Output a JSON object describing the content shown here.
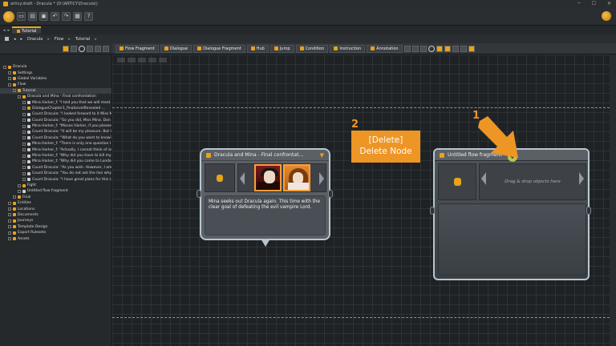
{
  "window": {
    "title": "articy:draft - Dracula * (D:\\ARTICY\\Dracula\\)"
  },
  "tabs": [
    {
      "label": "Tutorial"
    }
  ],
  "breadcrumb": {
    "items": [
      "Dracula",
      "Flow",
      "Tutorial"
    ]
  },
  "editor_toolbar": {
    "items": [
      "Flow Fragment",
      "Dialogue",
      "Dialogue Fragment",
      "Hub",
      "Jump",
      "Condition",
      "Instruction",
      "Annotation"
    ]
  },
  "tree": {
    "items": [
      {
        "label": "Dracula",
        "level": 0,
        "icon": "project-icon"
      },
      {
        "label": "Settings",
        "level": 1,
        "icon": "gear-icon"
      },
      {
        "label": "Global Variables",
        "level": 1,
        "icon": "variables-icon"
      },
      {
        "label": "Flow",
        "level": 1,
        "icon": "folder-icon"
      },
      {
        "label": "Tutorial",
        "level": 2,
        "icon": "folder-icon",
        "selected": true
      },
      {
        "label": "Dracula and Mina - Final confrontation",
        "level": 3,
        "icon": "dialogue-icon"
      },
      {
        "label": "Mina Harker_f: \"I told you that we will meet a",
        "level": 4,
        "icon": "fragment-icon"
      },
      {
        "label": "DialogueChapter1_finalLevelRevealed ...",
        "level": 4,
        "icon": "condition-icon"
      },
      {
        "label": "Count Dracula: \"I looked forward to it Miss M",
        "level": 4,
        "icon": "fragment-icon"
      },
      {
        "label": "Count Dracula: \"So you did, Miss Mina.  Don",
        "level": 4,
        "icon": "fragment-icon"
      },
      {
        "label": "Mina Harker_f: \"Misses Harker, if you please.",
        "level": 4,
        "icon": "fragment-icon"
      },
      {
        "label": "Count Dracula: \"It will be my pleasure. But I",
        "level": 4,
        "icon": "fragment-icon"
      },
      {
        "label": "Count Dracula: \"What do you want to know?",
        "level": 4,
        "icon": "fragment-icon"
      },
      {
        "label": "Mina Harker_f: \"There is only one question I",
        "level": 4,
        "icon": "fragment-icon"
      },
      {
        "label": "Mina Harker_f: \"Actually, I cannot think of an",
        "level": 4,
        "icon": "fragment-icon"
      },
      {
        "label": "Mina Harker_f: \"Why did you have to kill my",
        "level": 4,
        "icon": "fragment-icon"
      },
      {
        "label": "Mina Harker_f: \"Why did you come to Londo",
        "level": 4,
        "icon": "fragment-icon"
      },
      {
        "label": "Count Dracula: \"As you wish. However, I am",
        "level": 4,
        "icon": "fragment-icon"
      },
      {
        "label": "Count Dracula: \"You do not ask the lion why",
        "level": 4,
        "icon": "fragment-icon"
      },
      {
        "label": "Count Dracula: \"I have great plans for this cit",
        "level": 4,
        "icon": "fragment-icon"
      },
      {
        "label": "Fight",
        "level": 3,
        "icon": "folder-icon"
      },
      {
        "label": "Untitled flow fragment",
        "level": 3,
        "icon": "fragment-icon"
      },
      {
        "label": "Final",
        "level": 2,
        "icon": "folder-icon"
      },
      {
        "label": "Entities",
        "level": 1,
        "icon": "entities-icon"
      },
      {
        "label": "Locations",
        "level": 1,
        "icon": "locations-icon"
      },
      {
        "label": "Documents",
        "level": 1,
        "icon": "documents-icon"
      },
      {
        "label": "Journeys",
        "level": 1,
        "icon": "journeys-icon"
      },
      {
        "label": "Template Design",
        "level": 1,
        "icon": "template-icon"
      },
      {
        "label": "Export Rulesets",
        "level": 1,
        "icon": "export-icon"
      },
      {
        "label": "Assets",
        "level": 1,
        "icon": "assets-icon"
      }
    ]
  },
  "dialogue_node": {
    "title": "Dracula and Mina - Final confrontat...",
    "text": "Mina seeks out Dracula again. This time with the clear goal of defeating the evil vampire Lord."
  },
  "flow_fragment_node": {
    "title": "Untitled flow fragment",
    "drop_hint": "Drag & drop objects here"
  },
  "annotation": {
    "callout_line1": "[Delete]",
    "callout_line2": "Delete Node",
    "step1": "1",
    "step2": "2",
    "accent": "#ED9525"
  }
}
